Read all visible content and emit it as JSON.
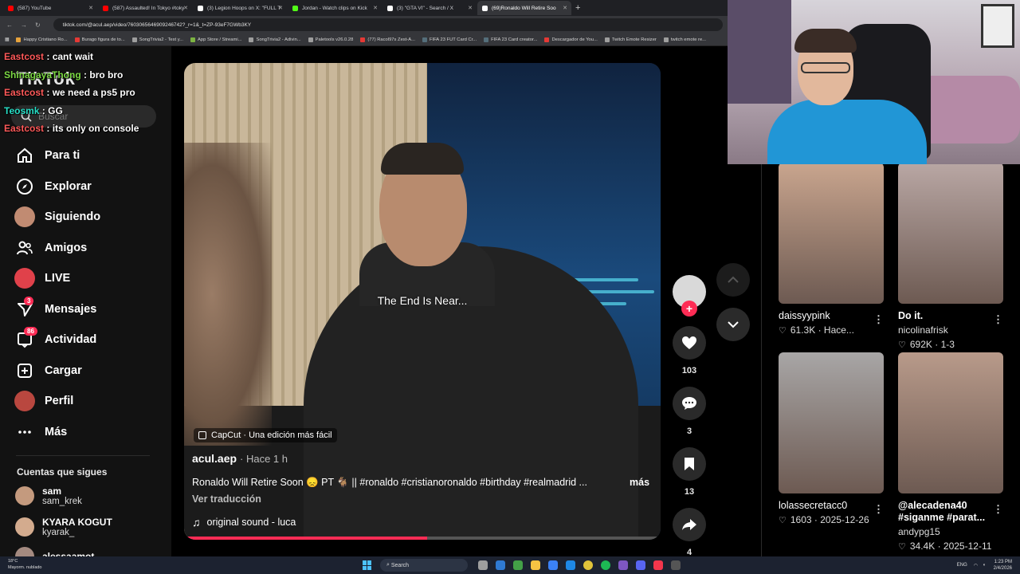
{
  "browser": {
    "tabs": [
      {
        "label": "(587) YouTube",
        "color": "#ff0000",
        "active": false
      },
      {
        "label": "(587) Assaulted! In Tokyo #toky",
        "color": "#ff0000",
        "active": false
      },
      {
        "label": "(3) Legion Hoops on X: \"FULL T",
        "color": "#ffffff",
        "active": false
      },
      {
        "label": "Jordan - Watch clips on Kick",
        "color": "#53fc18",
        "active": false
      },
      {
        "label": "(3) \"GTA VI\" - Search / X",
        "color": "#ffffff",
        "active": false
      },
      {
        "label": "(69)Ronaldo Will Retire Soo",
        "color": "#ffffff",
        "active": true
      }
    ],
    "url": "tiktok.com/@acul.aep/video/7603065646909246742?_r=1&_t=ZP-93eF7GWb3KY",
    "bookmarks": [
      {
        "label": "Happy Cristiano Ro...",
        "color": "#e6a23c"
      },
      {
        "label": "Burago figura de to...",
        "color": "#e53935"
      },
      {
        "label": "SongTrivia2 - Test y...",
        "color": "#9e9e9e"
      },
      {
        "label": "App Store / Streami...",
        "color": "#7cb342"
      },
      {
        "label": "SongTrivia2 - Adivin...",
        "color": "#9e9e9e"
      },
      {
        "label": "Paletools v26.0.28",
        "color": "#9e9e9e"
      },
      {
        "label": "(77) Racol97s Zest-A...",
        "color": "#e53935"
      },
      {
        "label": "FIFA 23 FUT Card Cr...",
        "color": "#546e7a"
      },
      {
        "label": "FIFA 23 Card creator...",
        "color": "#546e7a"
      },
      {
        "label": "Descargador de You...",
        "color": "#e53935"
      },
      {
        "label": "Twitch Emote Resizer",
        "color": "#9e9e9e"
      },
      {
        "label": "twitch emote re...",
        "color": "#9e9e9e"
      }
    ]
  },
  "sidebar": {
    "logo": "TikTok",
    "search_placeholder": "Buscar",
    "items": [
      {
        "label": "Para ti",
        "icon": "home-icon"
      },
      {
        "label": "Explorar",
        "icon": "compass-icon"
      },
      {
        "label": "Siguiendo",
        "icon": "following-avatar"
      },
      {
        "label": "Amigos",
        "icon": "friends-icon"
      },
      {
        "label": "LIVE",
        "icon": "live-avatar"
      },
      {
        "label": "Mensajes",
        "icon": "send-icon",
        "badge": "3"
      },
      {
        "label": "Actividad",
        "icon": "inbox-icon",
        "badge": "86"
      },
      {
        "label": "Cargar",
        "icon": "upload-icon"
      },
      {
        "label": "Perfil",
        "icon": "profile-avatar"
      },
      {
        "label": "Más",
        "icon": "more-icon"
      }
    ],
    "following_title": "Cuentas que sigues",
    "accounts": [
      {
        "name": "sam",
        "handle": "sam_krek"
      },
      {
        "name": "KYARA KOGUT",
        "handle": "kyarak_"
      },
      {
        "name": "alessaamot",
        "handle": ""
      }
    ]
  },
  "chat": [
    {
      "user": "Eastcost",
      "msg": "cant wait",
      "color": "red"
    },
    {
      "user": "ShinagayaThong",
      "msg": "bro bro",
      "color": "green"
    },
    {
      "user": "Eastcost",
      "msg": "we need a ps5 pro",
      "color": "red"
    },
    {
      "user": "Teosmk",
      "msg": "GG",
      "color": "cyan"
    },
    {
      "user": "Eastcost",
      "msg": "its only on console",
      "color": "red"
    }
  ],
  "video": {
    "overlay_caption": "The End Is Near...",
    "capcut_label": "CapCut · Una edición más fácil",
    "author": "acul.aep",
    "time": "· Hace 1 h",
    "description": "Ronaldo Will Retire Soon 😞 PT 🐐 || #ronaldo #cristianoronaldo #birthday #realmadrid ...",
    "more_label": "más",
    "translate_label": "Ver traducción",
    "sound": "original sound - luca",
    "progress": 0.51
  },
  "actions": {
    "likes": "103",
    "comments": "3",
    "saves": "13",
    "shares": "4"
  },
  "grid": [
    {
      "caption": "daissyypink",
      "user": "",
      "likes": "61.3K",
      "date": "Hace...",
      "caption_bold": false,
      "thumb_color": "#c9a58e"
    },
    {
      "caption": "Do it.",
      "user": "nicolinafrisk",
      "likes": "692K",
      "date": "1-3",
      "caption_bold": true,
      "thumb_color": "#b9a7a4"
    },
    {
      "caption": "lolassecretacc0",
      "user": "",
      "likes": "1603",
      "date": "2025-12-26",
      "caption_bold": false,
      "thumb_color": "#a8a6a6"
    },
    {
      "caption": "@alecadena40 #siganme #parat...",
      "user": "andypg15",
      "likes": "34.4K",
      "date": "2025-12-11",
      "caption_bold": true,
      "thumb_color": "#b89a8a"
    }
  ],
  "taskbar": {
    "weather_temp": "18°C",
    "weather_desc": "Mayorm. nublado",
    "search": "Search",
    "lang": "ENG",
    "time": "1:23 PM",
    "date": "2/4/2026"
  }
}
